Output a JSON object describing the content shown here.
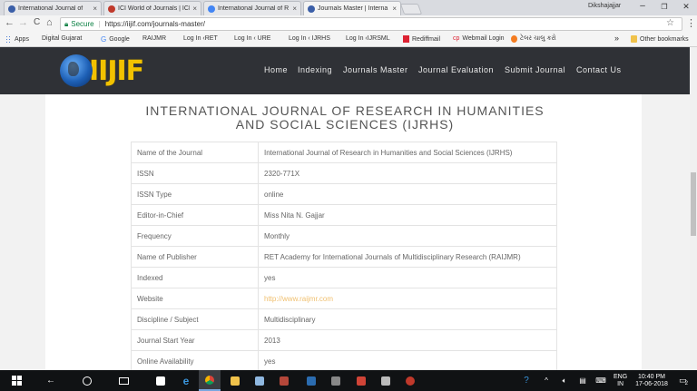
{
  "browser": {
    "tabs": [
      {
        "title": "International Journal of",
        "favicon_color": "#3b5fa8",
        "active": false
      },
      {
        "title": "ICI World of Journals | ICI",
        "favicon_color": "#c0392b",
        "active": false
      },
      {
        "title": "International Journal of R",
        "favicon_color": "#4285f4",
        "active": false
      },
      {
        "title": "Journals Master | Interna",
        "favicon_color": "#3b5fa8",
        "active": true
      }
    ],
    "tab_close": "×",
    "user_name": "Dikshajajjar",
    "window_controls": {
      "minimize": "–",
      "maximize": "❐",
      "close": "✕"
    },
    "nav": {
      "back": "←",
      "forward": "→",
      "reload": "C",
      "home": "⌂"
    },
    "secure_label": "Secure",
    "url": "https://iijif.com/journals-master/",
    "bookmarks": [
      {
        "label": "Apps",
        "icon": "apps-grid-icon"
      },
      {
        "label": "Digital Gujarat",
        "icon": "page-icon"
      },
      {
        "label": "Google",
        "icon": "google-icon"
      },
      {
        "label": "RAIJMR",
        "icon": "page-icon"
      },
      {
        "label": "Log In ‹RET",
        "icon": "page-icon"
      },
      {
        "label": "Log In ‹ URE",
        "icon": "page-icon"
      },
      {
        "label": "Log In ‹ IJRHS",
        "icon": "page-icon"
      },
      {
        "label": "Log In ‹IJRSML",
        "icon": "page-icon"
      },
      {
        "label": "Rediffmail",
        "icon": "rediffmail-icon"
      },
      {
        "label": "Webmail Login",
        "icon": "webmail-icon"
      },
      {
        "label": "ટેલર ચાલુ કરો",
        "icon": "orange-icon"
      }
    ],
    "bookmarks_overflow": "»",
    "other_bookmarks": "Other bookmarks"
  },
  "site": {
    "logo_text": "IIJIF",
    "nav_items": [
      "Home",
      "Indexing",
      "Journals Master",
      "Journal Evaluation",
      "Submit Journal",
      "Contact Us"
    ],
    "journal_title": "INTERNATIONAL JOURNAL OF RESEARCH IN HUMANITIES AND SOCIAL SCIENCES (IJRHS)",
    "rows": [
      {
        "key": "Name of the Journal",
        "value": "International Journal of Research in Humanities and Social Sciences (IJRHS)"
      },
      {
        "key": "ISSN",
        "value": "2320-771X"
      },
      {
        "key": "ISSN Type",
        "value": "online"
      },
      {
        "key": "Editor-in-Chief",
        "value": "Miss Nita N. Gajjar"
      },
      {
        "key": "Frequency",
        "value": "Monthly"
      },
      {
        "key": "Name of Publisher",
        "value": "RET Academy for International Journals of Multidisciplinary Research (RAIJMR)"
      },
      {
        "key": "Indexed",
        "value": "yes"
      },
      {
        "key": "Website",
        "value": "http://www.raijmr.com",
        "link": true
      },
      {
        "key": "Discipline / Subject",
        "value": "Multidisciplinary"
      },
      {
        "key": "Journal Start Year",
        "value": "2013"
      },
      {
        "key": "Online Availability",
        "value": "yes"
      }
    ]
  },
  "taskbar": {
    "language": "ENG",
    "region": "IN",
    "time": "10:40 PM",
    "date": "17-06-2018",
    "notification_count": "2"
  }
}
